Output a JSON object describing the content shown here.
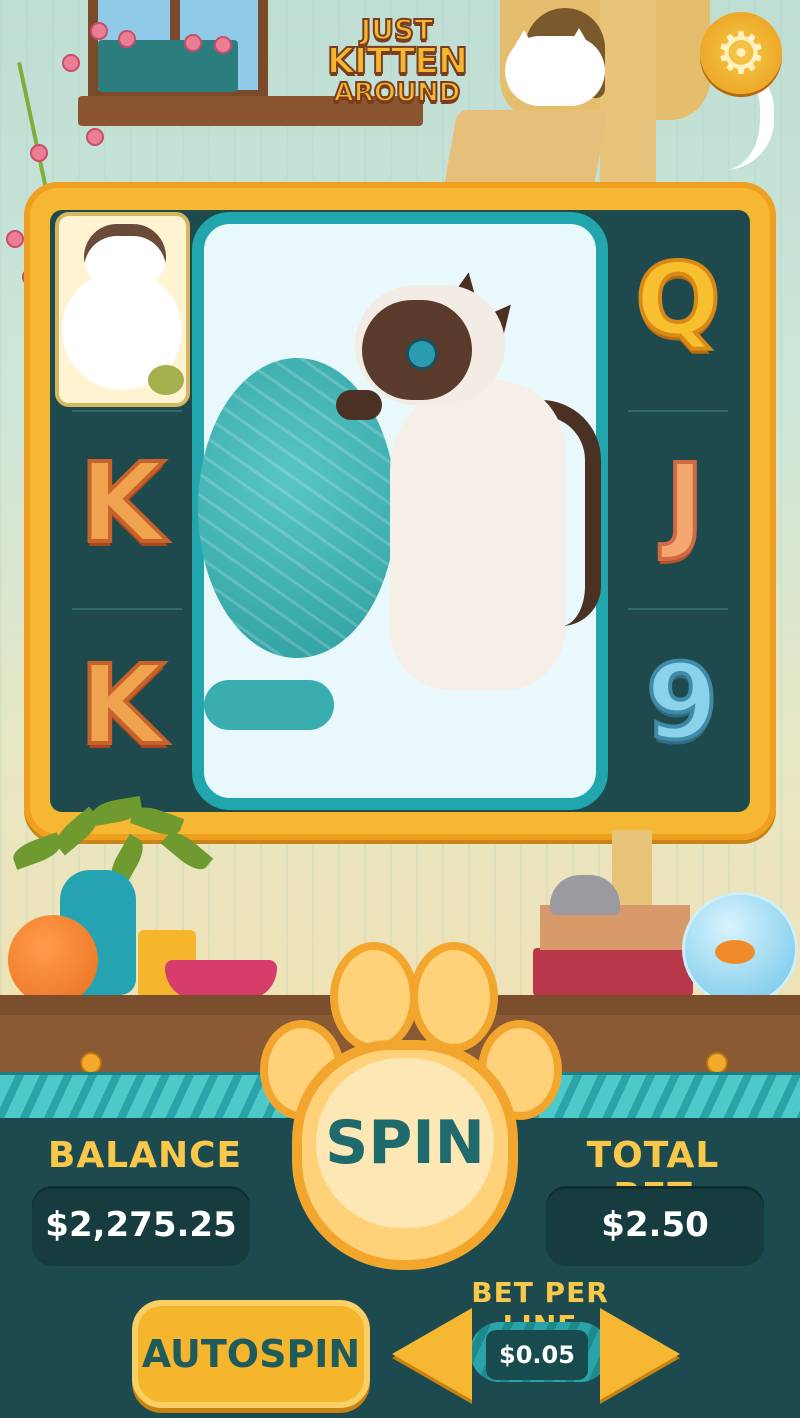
{
  "logo": {
    "line1": "JUST",
    "line2": "KITTEN",
    "line3": "AROUND"
  },
  "settings": {
    "icon": "gear-icon",
    "glyph": "⚙"
  },
  "reels": {
    "reel1": [
      {
        "symbol": "ragdoll-cat"
      },
      {
        "symbol": "letter-k",
        "glyph": "K"
      },
      {
        "symbol": "letter-k",
        "glyph": "K"
      }
    ],
    "reel2": [
      {
        "symbol": "siamese-cat-with-yarn",
        "size": "mega"
      }
    ],
    "reel3": [
      {
        "symbol": "letter-q",
        "glyph": "Q"
      },
      {
        "symbol": "letter-j",
        "glyph": "J"
      },
      {
        "symbol": "number-9",
        "glyph": "9"
      }
    ]
  },
  "balance": {
    "label": "BALANCE",
    "value": "$2,275.25"
  },
  "total_bet": {
    "label": "TOTAL BET",
    "value": "$2.50"
  },
  "spin": {
    "label": "SPIN"
  },
  "autospin": {
    "label": "AUTOSPIN"
  },
  "bet_per_line": {
    "label": "BET PER LINE",
    "value": "$0.05"
  },
  "colors": {
    "accent": "#f6b733",
    "panel": "#1d4a4e",
    "reel_bg": "#1e4a4d",
    "text_gold": "#f9c84a",
    "spin_text": "#1f6a6c"
  }
}
